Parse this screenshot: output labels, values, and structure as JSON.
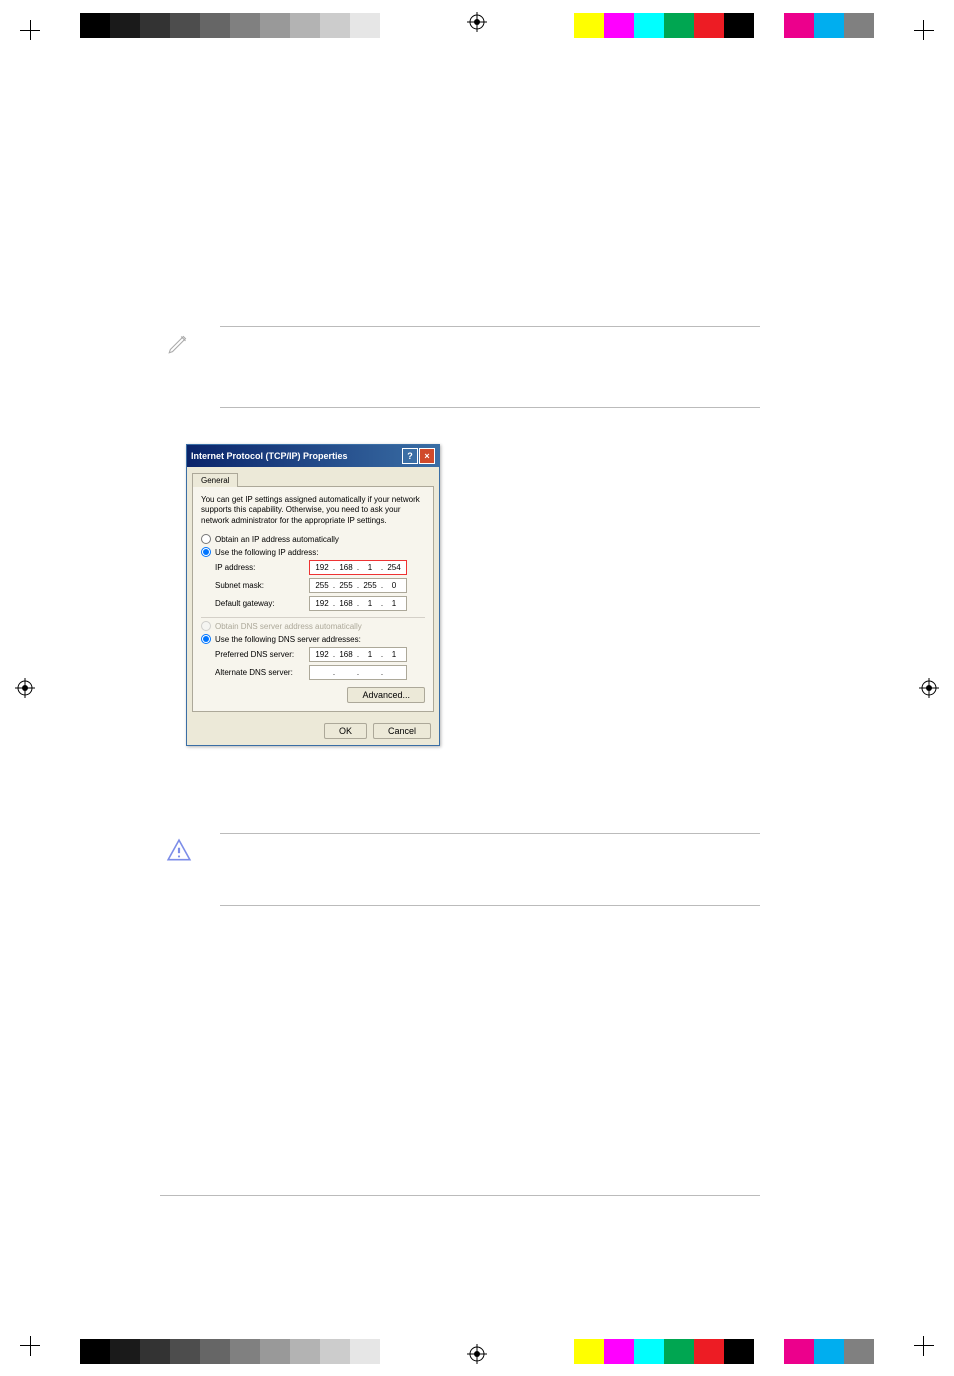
{
  "dialog": {
    "title": "Internet Protocol (TCP/IP) Properties",
    "tab": "General",
    "description": "You can get IP settings assigned automatically if your network supports this capability. Otherwise, you need to ask your network administrator for the appropriate IP settings.",
    "radio_auto_ip": "Obtain an IP address automatically",
    "radio_manual_ip": "Use the following IP address:",
    "ip_label": "IP address:",
    "ip_value": [
      "192",
      "168",
      "1",
      "254"
    ],
    "subnet_label": "Subnet mask:",
    "subnet_value": [
      "255",
      "255",
      "255",
      "0"
    ],
    "gateway_label": "Default gateway:",
    "gateway_value": [
      "192",
      "168",
      "1",
      "1"
    ],
    "radio_auto_dns": "Obtain DNS server address automatically",
    "radio_manual_dns": "Use the following DNS server addresses:",
    "pref_dns_label": "Preferred DNS server:",
    "pref_dns_value": [
      "192",
      "168",
      "1",
      "1"
    ],
    "alt_dns_label": "Alternate DNS server:",
    "alt_dns_value": [
      "",
      "",
      "",
      ""
    ],
    "advanced_btn": "Advanced...",
    "ok_btn": "OK",
    "cancel_btn": "Cancel"
  },
  "print": {
    "grays": [
      "#000000",
      "#1a1a1a",
      "#333333",
      "#4d4d4d",
      "#666666",
      "#808080",
      "#999999",
      "#b3b3b3",
      "#cccccc",
      "#e6e6e6"
    ],
    "colors": [
      "#ffff00",
      "#ff00ff",
      "#00ffff",
      "#00a651",
      "#ed1c24",
      "#000000",
      "#ffffff",
      "#ec008c",
      "#00aeef",
      "#808080"
    ]
  }
}
